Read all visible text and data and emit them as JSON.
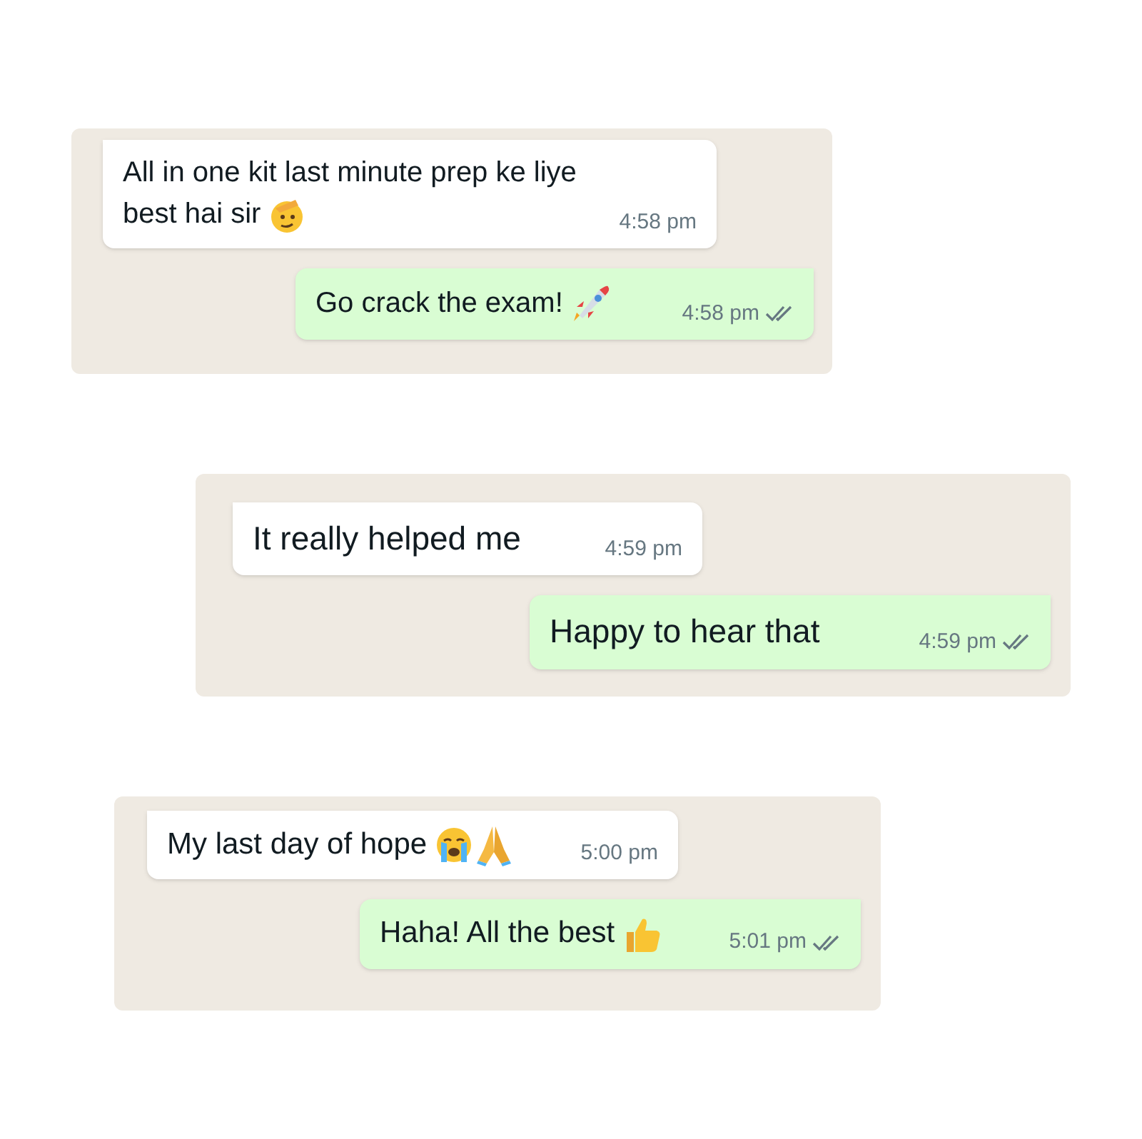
{
  "chats": [
    {
      "messages": [
        {
          "outgoing": false,
          "text": "All in one kit last minute prep ke liye best hai sir",
          "emoji": [
            {
              "kind": "salute"
            }
          ],
          "time": "4:58 pm"
        },
        {
          "outgoing": true,
          "text": "Go crack the exam!",
          "emoji": [
            {
              "kind": "rocket"
            }
          ],
          "time": "4:58 pm",
          "delivered": true
        }
      ]
    },
    {
      "messages": [
        {
          "outgoing": false,
          "text": "It really helped me",
          "time": "4:59 pm"
        },
        {
          "outgoing": true,
          "text": "Happy to hear that",
          "time": "4:59 pm",
          "delivered": true
        }
      ]
    },
    {
      "messages": [
        {
          "outgoing": false,
          "text": "My last day of hope",
          "emoji": [
            {
              "kind": "crying"
            },
            {
              "kind": "pray"
            }
          ],
          "time": "5:00 pm"
        },
        {
          "outgoing": true,
          "text": "Haha! All the best",
          "emoji": [
            {
              "kind": "thumbs"
            }
          ],
          "time": "5:01 pm",
          "delivered": true
        }
      ]
    }
  ]
}
